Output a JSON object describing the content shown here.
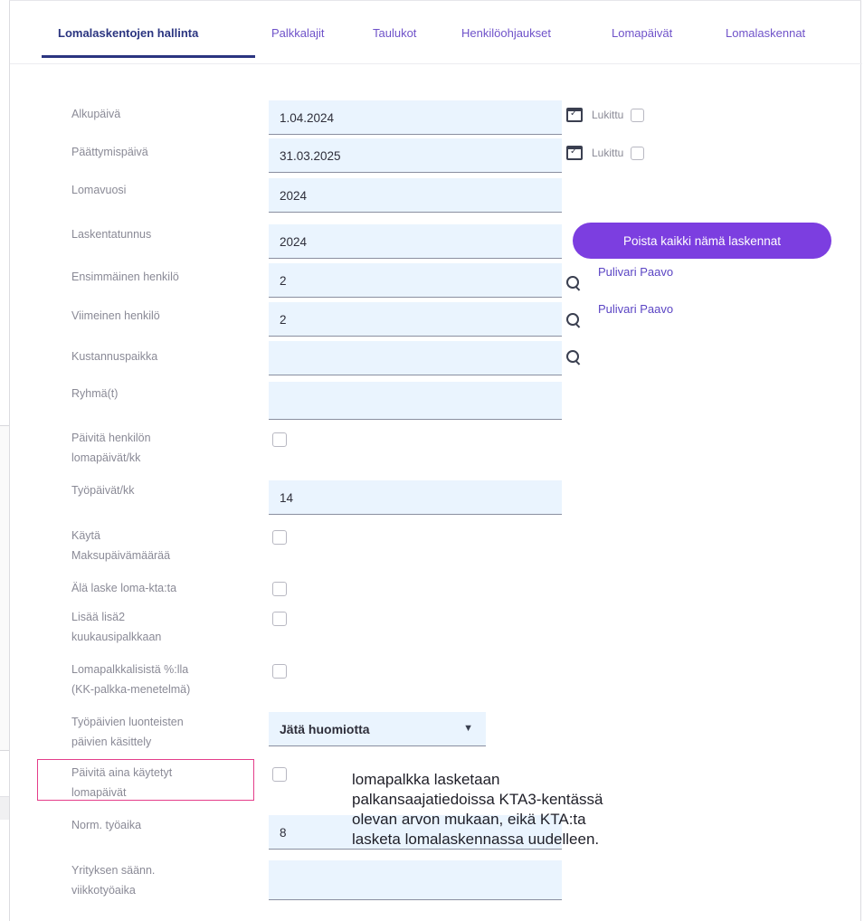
{
  "tabs": [
    {
      "label": "Lomalaskentojen hallinta",
      "active": true
    },
    {
      "label": "Palkkalajit"
    },
    {
      "label": "Taulukot"
    },
    {
      "label": "Henkilöohjaukset"
    },
    {
      "label": "Lomapäivät"
    },
    {
      "label": "Lomalaskennat"
    }
  ],
  "form": {
    "alkupaiva": {
      "label": "Alkupäivä",
      "value": "1.04.2024",
      "lock_label": "Lukittu"
    },
    "paattymispaiva": {
      "label": "Päättymispäivä",
      "value": "31.03.2025",
      "lock_label": "Lukittu"
    },
    "lomavuosi": {
      "label": "Lomavuosi",
      "value": "2024"
    },
    "laskentatunnus": {
      "label": "Laskentatunnus",
      "value": "2024"
    },
    "ensimmainen": {
      "label": "Ensimmäinen henkilö",
      "value": "2",
      "person": "Pulivari Paavo"
    },
    "viimeinen": {
      "label": "Viimeinen henkilö",
      "value": "2",
      "person": "Pulivari Paavo"
    },
    "kustannuspaikka": {
      "label": "Kustannuspaikka",
      "value": ""
    },
    "ryhmat": {
      "label": "Ryhmä(t)",
      "value": ""
    },
    "paivita_lomapaivat": {
      "label_1": "Päivitä henkilön",
      "label_2": "lomapäivät/kk"
    },
    "tyopaivat": {
      "label": "Työpäivät/kk",
      "value": "14"
    },
    "kayta_maksupaiva": {
      "label_1": "Käytä",
      "label_2": "Maksupäivämäärää"
    },
    "ala_laske": {
      "label": "Älä laske loma-kta:ta"
    },
    "lisaa_lisa2": {
      "label_1": "Lisää lisä2",
      "label_2": "kuukausipalkkaan"
    },
    "lomapalkkalisista": {
      "label_1": "Lomapalkkalisistä %:lla",
      "label_2": "(KK-palkka-menetelmä)"
    },
    "luonteisten": {
      "label_1": "Työpäivien luonteisten",
      "label_2": "päivien käsittely",
      "value": "Jätä huomiotta"
    },
    "paivita_kaytetyt": {
      "label_1": "Päivitä aina käytetyt",
      "label_2": "lomapäivät"
    },
    "norm_tyoaika": {
      "label": "Norm. työaika",
      "value": "8"
    },
    "yrityksen": {
      "label_1": "Yrityksen säänn.",
      "label_2": "viikkotyöaika",
      "value": ""
    }
  },
  "buttons": {
    "delete_all": "Poista kaikki nämä laskennat"
  },
  "note": {
    "line1": "lomapalkka lasketaan",
    "line2": "palkansaajatiedoissa KTA3-kentässä",
    "line3": "olevan arvon mukaan, eikä KTA:ta",
    "line4": "lasketa lomalaskennassa uudelleen."
  },
  "colors": {
    "accent": "#7c3ee0",
    "tab_active": "#2b3580",
    "field_bg": "#eaf4fe",
    "highlight": "#e43d8a"
  }
}
